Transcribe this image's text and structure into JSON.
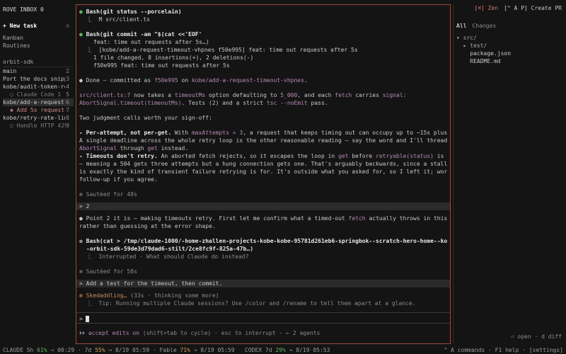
{
  "sidebar": {
    "brand": "ROVE INBOX 0",
    "new_task": "+ New task",
    "new_task_key": "n",
    "nav": [
      "Kanban",
      "Routines"
    ],
    "project": "orbit-sdk",
    "items": [
      {
        "label": "main",
        "count": "2",
        "type": "branch"
      },
      {
        "label": "Port the docs snipp",
        "count": "3",
        "type": "branch"
      },
      {
        "label": "kobe/audit-token-re",
        "count": "4",
        "type": "branch"
      },
      {
        "label": "○ Claude Code 1",
        "count": "5",
        "type": "sub"
      },
      {
        "label": "kobe/add-a-request-",
        "count": "6",
        "type": "branch",
        "selected": true
      },
      {
        "label": "✱ Add 5s request t",
        "count": "7",
        "type": "sub-pink"
      },
      {
        "label": "kobe/retry-rate-lim",
        "count": "8",
        "type": "branch"
      },
      {
        "label": "○ Handle HTTP 429",
        "count": "9",
        "type": "sub"
      }
    ]
  },
  "transcript": {
    "cmd1": "Bash(git status --porcelain)",
    "cmd1_out": "⎿  M src/client.ts",
    "cmd2": "Bash(git commit -am \"$(cat <<'EOF'",
    "cmd2_l2": "feat: time out requests after 5s…)",
    "cmd2_out1": "⎿  [kobe/add-a-request-timeout-vhpnes f50e995] feat: time out requests after 5s",
    "cmd2_out2": "1 file changed, 8 insertions(+), 2 deletions(-)",
    "cmd2_out3": "f50e995 feat: time out requests after 5s",
    "done_a": "Done — committed as ",
    "done_hash": "f50e995",
    "done_b": " on ",
    "done_branch": "kobe/add-a-request-timeout-vhpnes",
    "done_c": ".",
    "p1_l1a": "src/client.ts:7",
    "p1_l1b": " now takes a ",
    "p1_l1c": "timeoutMs",
    "p1_l1d": " option defaulting to ",
    "p1_l1e": "5_000",
    "p1_l1f": ", and each ",
    "p1_l1g": "fetch",
    "p1_l1h": " carries ",
    "p1_l1i": "signal:",
    "p1_l2a": "AbortSignal.timeout(timeoutMs)",
    "p1_l2b": ". Tests (2) and a strict ",
    "p1_l2c": "tsc --noEmit",
    "p1_l2d": " pass.",
    "p2": "Two judgment calls worth your sign-off:",
    "b1_head": "- Per-attempt, not per-get.",
    "b1_l1a": " With ",
    "b1_l1b": "maxAttempts = 3",
    "b1_l1c": ", a request that keeps timing out can occupy up to ~15s plus backoff.",
    "b1_l2": "A single deadline across the whole retry loop is the other reasonable reading — say the word and I'll thread one",
    "b1_l3a": "AbortSignal",
    "b1_l3b": " through ",
    "b1_l3c": "get",
    "b1_l3d": " instead.",
    "b2_head": "- Timeouts don't retry.",
    "b2_l1a": " An aborted fetch rejects, so it escapes the loop in ",
    "b2_l1b": "get",
    "b2_l1c": " before ",
    "b2_l1d": "retryable(status)",
    "b2_l1e": " is consulted",
    "b2_l2": "— meaning a 504 gets three attempts but a hung connection gets one. That's arguably backwards, since a stalled request",
    "b2_l3": "is exactly the kind of transient failure retrying is for. It's outside what you asked for, so I left it; worth a",
    "b2_l4": "follow-up if you agree.",
    "sauteed1": "✻ Sautéed for 48s",
    "user1": "> 2",
    "r2_l1a": "Point 2 it is — making timeouts retry. First let me confirm what a timed-out ",
    "r2_l1b": "fetch",
    "r2_l1c": " actually throws in this runtime,",
    "r2_l2": "rather than guessing at the error shape.",
    "cmd3_l1": "Bash(cat > /tmp/claude-1000/-home-zhallen-projects-kobe-kobe-95781d261eb6-springbok--scratch-hero-home--kobe-worktrees",
    "cmd3_l2": "-orbit-sdk-59de3d79dad6-stilt/2ce8fc9f-825a-47b…)",
    "cmd3_out": "⎿  Interrupted · What should Claude do instead?",
    "sauteed2": "✻ Sautéed for 58s",
    "user2": "> Add a test for the timeout, then commit.",
    "status_a": "✻ Skedaddling… ",
    "status_b": "(33s · thinking some more)",
    "tip": "⎿  Tip: Running multiple Claude sessions? Use /color and /rename to tell them apart at a glance."
  },
  "input": {
    "prompt": ">"
  },
  "hint": {
    "icon": "⏵⏵",
    "accent": "accept edits on",
    "rest": " (shift+tab to cycle) · esc to interrupt · ← 2 agents"
  },
  "right": {
    "zen": "[⌘] Zen",
    "create": "[^ A P] Create PR",
    "tab_all": "All",
    "tab_changes": "Changes",
    "tree": [
      {
        "text": "▾ src/",
        "kind": "dir"
      },
      {
        "text": "  ▸ test/",
        "kind": "dir"
      },
      {
        "text": "    package.json",
        "kind": "file"
      },
      {
        "text": "    README.md",
        "kind": "file"
      }
    ],
    "footer": "⏎ open · d diff"
  },
  "statusbar": {
    "a": "CLAUDE 5h ",
    "a_pct": "61%",
    "b": " → 00:29 · 7d ",
    "b_pct": "55%",
    "c": " → 8/19 05:59 · Fable ",
    "c_pct": "71%",
    "d": " → 8/19 05:59   CODEX 7d ",
    "d_pct": "29%",
    "e": " → 8/19 05:53",
    "right": "^ A commands · F1 help · [settings]"
  },
  "colors": {
    "accent_border": "#9a4a3a",
    "green": "#5fb55f",
    "orange": "#d08a5a",
    "purple": "#b58ab5"
  }
}
